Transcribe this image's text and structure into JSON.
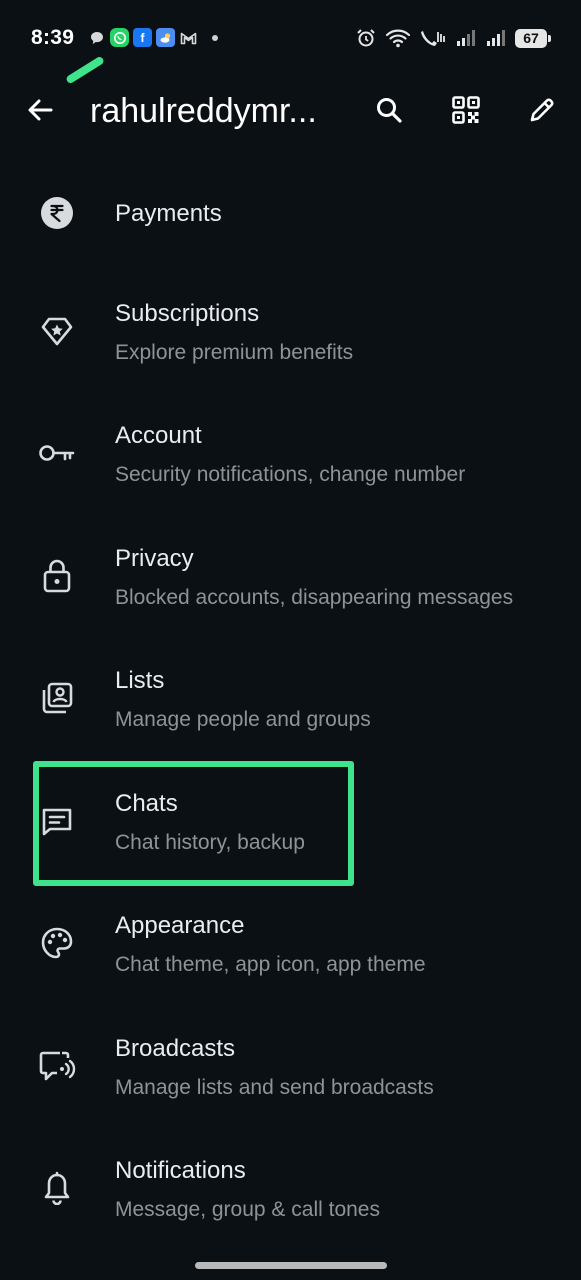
{
  "status_bar": {
    "time": "8:39",
    "battery": "67",
    "notification_icons": [
      "chat-bubble-icon",
      "whatsapp-icon",
      "facebook-icon",
      "weather-icon",
      "gmail-icon"
    ],
    "system_icons": [
      "alarm-icon",
      "wifi-icon",
      "volte-call-icon",
      "signal-icon",
      "signal-icon",
      "battery-icon"
    ]
  },
  "header": {
    "title": "rahulreddymr...",
    "actions": [
      "search-icon",
      "qr-code-icon",
      "pencil-icon"
    ]
  },
  "settings": {
    "items": [
      {
        "label": "Payments",
        "sub": "",
        "icon": "rupee-icon"
      },
      {
        "label": "Subscriptions",
        "sub": "Explore premium benefits",
        "icon": "diamond-star-icon"
      },
      {
        "label": "Account",
        "sub": "Security notifications, change number",
        "icon": "key-icon"
      },
      {
        "label": "Privacy",
        "sub": "Blocked accounts, disappearing messages",
        "icon": "lock-icon"
      },
      {
        "label": "Lists",
        "sub": "Manage people and groups",
        "icon": "contact-list-icon"
      },
      {
        "label": "Chats",
        "sub": "Chat history, backup",
        "icon": "chat-icon"
      },
      {
        "label": "Appearance",
        "sub": "Chat theme, app icon, app theme",
        "icon": "palette-icon"
      },
      {
        "label": "Broadcasts",
        "sub": "Manage lists and send broadcasts",
        "icon": "broadcast-icon"
      },
      {
        "label": "Notifications",
        "sub": "Message, group & call tones",
        "icon": "bell-icon"
      }
    ]
  },
  "colors": {
    "background": "#0b1014",
    "text_primary": "#e9edef",
    "text_secondary": "#8d9499",
    "highlight": "#3ee38b"
  }
}
